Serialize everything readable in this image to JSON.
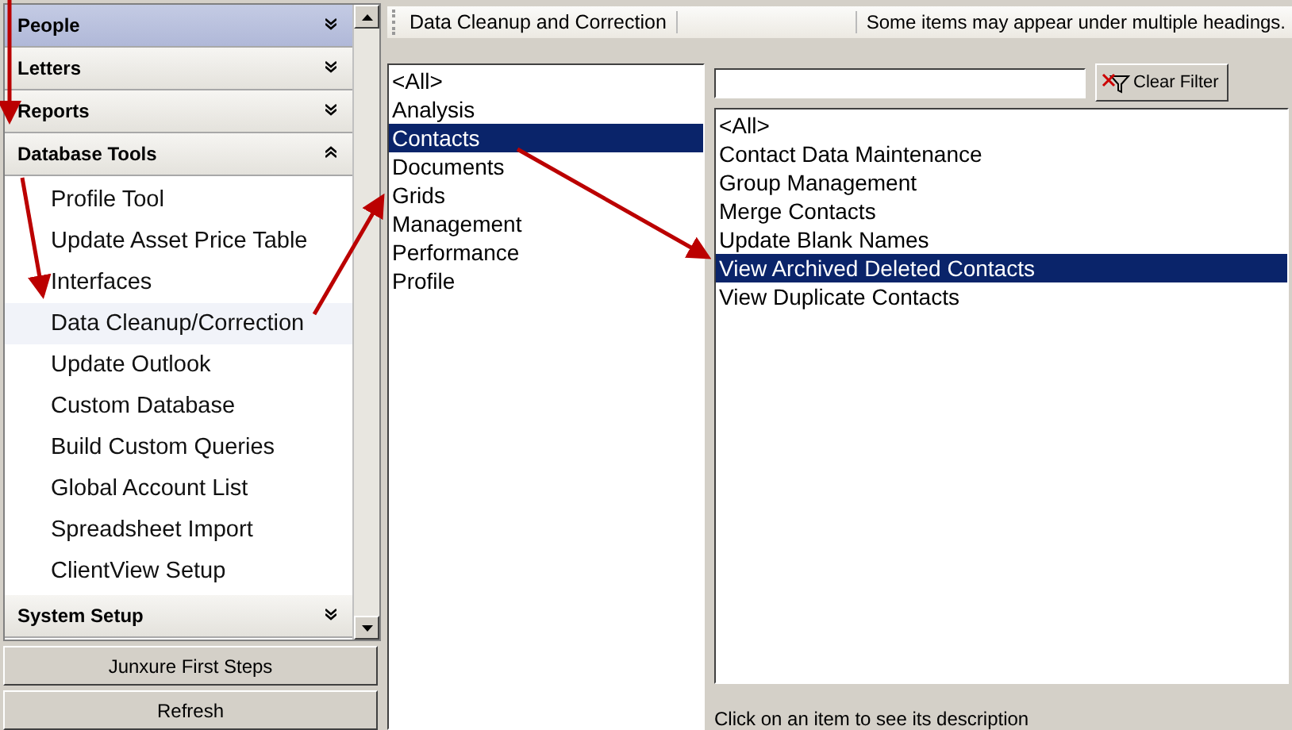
{
  "sidebar": {
    "sections": [
      {
        "title": "People",
        "selected": true,
        "expanded": false
      },
      {
        "title": "Letters",
        "selected": false,
        "expanded": false
      },
      {
        "title": "Reports",
        "selected": false,
        "expanded": false
      },
      {
        "title": "Database Tools",
        "selected": false,
        "expanded": true,
        "items": [
          {
            "label": "Profile Tool",
            "selected": false
          },
          {
            "label": "Update Asset Price Table",
            "selected": false
          },
          {
            "label": "Interfaces",
            "selected": false
          },
          {
            "label": "Data Cleanup/Correction",
            "selected": true
          },
          {
            "label": "Update Outlook",
            "selected": false
          },
          {
            "label": "Custom Database",
            "selected": false
          },
          {
            "label": "Build Custom Queries",
            "selected": false
          },
          {
            "label": "Global Account List",
            "selected": false
          },
          {
            "label": "Spreadsheet Import",
            "selected": false
          },
          {
            "label": "ClientView Setup",
            "selected": false
          }
        ]
      },
      {
        "title": "System Setup",
        "selected": false,
        "expanded": false
      }
    ],
    "buttons": [
      "Junxure First Steps",
      "Refresh"
    ]
  },
  "toolbar": {
    "title": "Data Cleanup and Correction",
    "note": "Some items may appear under multiple headings."
  },
  "categories": [
    {
      "label": "<All>",
      "selected": false
    },
    {
      "label": "Analysis",
      "selected": false
    },
    {
      "label": "Contacts",
      "selected": true
    },
    {
      "label": "Documents",
      "selected": false
    },
    {
      "label": "Grids",
      "selected": false
    },
    {
      "label": "Management",
      "selected": false
    },
    {
      "label": "Performance",
      "selected": false
    },
    {
      "label": "Profile",
      "selected": false
    }
  ],
  "filter": {
    "clear_button": "Clear Filter"
  },
  "tools": [
    {
      "label": "<All>",
      "selected": false
    },
    {
      "label": "Contact Data Maintenance",
      "selected": false
    },
    {
      "label": "Group Management",
      "selected": false
    },
    {
      "label": "Merge Contacts",
      "selected": false
    },
    {
      "label": "Update Blank Names",
      "selected": false
    },
    {
      "label": "View Archived Deleted Contacts",
      "selected": true
    },
    {
      "label": "View Duplicate Contacts",
      "selected": false
    }
  ],
  "description": "Click on an item to see its description"
}
